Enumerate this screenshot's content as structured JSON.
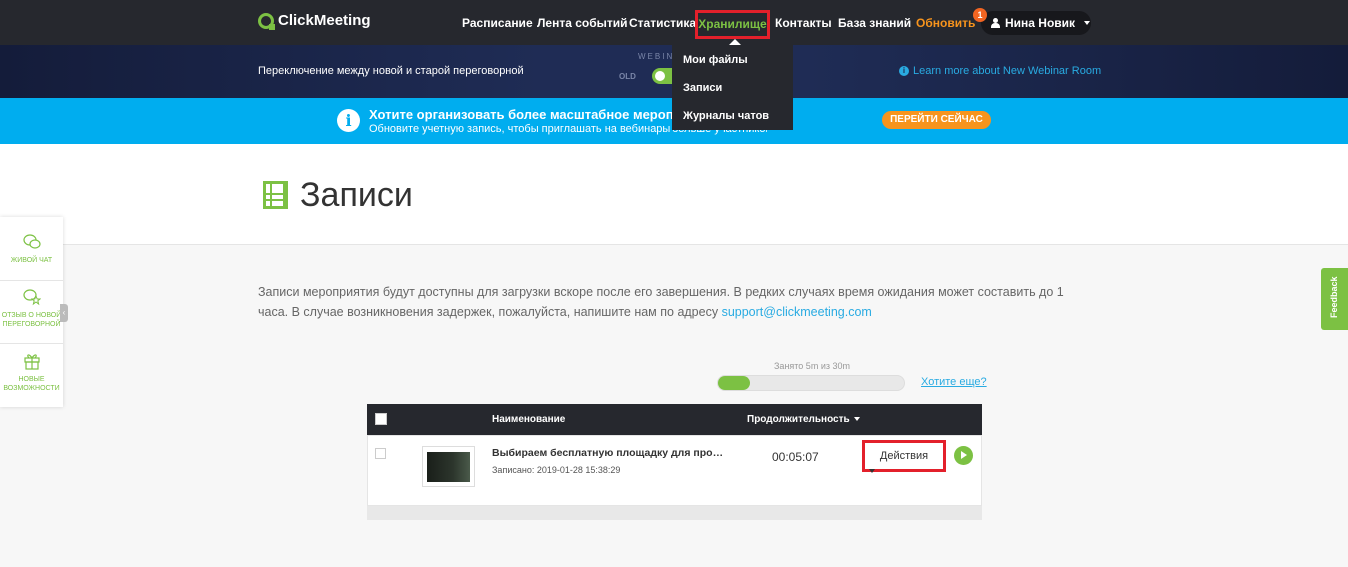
{
  "brand": {
    "name": "ClickMeeting"
  },
  "nav": {
    "items": [
      "Расписание",
      "Лента событий",
      "Статистика"
    ],
    "active": "Хранилище",
    "contacts": "Контакты",
    "knowledge_base": "База знаний",
    "upgrade": "Обновить",
    "notification_count": "1",
    "user_name": "Нина Новик"
  },
  "storage_menu": {
    "items": [
      "Мои файлы",
      "Записи",
      "Журналы чатов"
    ]
  },
  "webinar_strip": {
    "text": "Переключение между новой и старой переговорной",
    "webinar_label": "WEBINAR",
    "old_label": "OLD",
    "toggle_state": "new",
    "learn_more": "Learn more about New Webinar Room"
  },
  "banner": {
    "title": "Хотите организовать более масштабное мероприятие?",
    "subtitle": "Обновите учетную запись, чтобы приглашать на вебинары больше участников.",
    "subtitle_visible_part": "больше участников.",
    "cta": "ПЕРЕЙТИ СЕЙЧАС"
  },
  "page": {
    "title": "Записи",
    "info_text": "Записи мероприятия будут доступны для загрузки вскоре после его завершения. В редких случаях время ожидания может составить до 1 часа. В случае возникновения задержек, пожалуйста, напишите нам по адресу ",
    "support_email": "support@clickmeeting.com"
  },
  "side_widget": {
    "items": [
      "ЖИВОЙ ЧАТ",
      "ОТЗЫВ О НОВОЙ ПЕРЕГОВОРНОЙ",
      "НОВЫЕ ВОЗМОЖНОСТИ"
    ]
  },
  "feedback": "Feedback",
  "storage": {
    "usage_label": "Занято 5m из 30m",
    "used_fraction": 0.17,
    "more_link": "Хотите еще?"
  },
  "table": {
    "col_name": "Наименование",
    "col_duration": "Продолжительность",
    "rows": [
      {
        "title": "Выбираем бесплатную площадку для проведения вебинаров",
        "recorded": "Записано: 2019-01-28 15:38:29",
        "duration": "00:05:07",
        "actions_label": "Действия"
      }
    ]
  },
  "colors": {
    "accent": "#7cc143",
    "topbar": "#26282e",
    "banner": "#00adef",
    "highlight": "#e3202b",
    "upgrade": "#f7941d"
  }
}
